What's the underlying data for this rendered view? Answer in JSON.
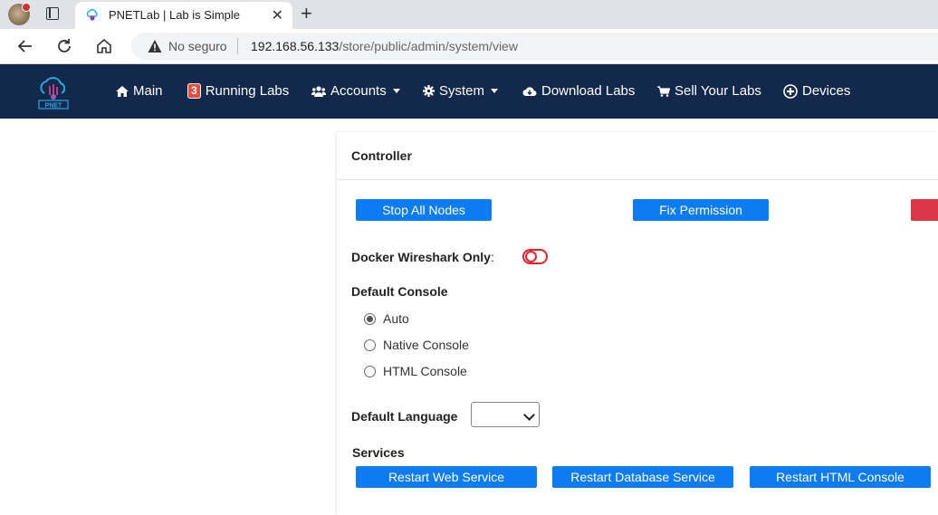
{
  "browser": {
    "tab_title": "PNETLab | Lab is Simple",
    "close_symbol": "✕",
    "new_tab_symbol": "+",
    "security_label": "No seguro",
    "url_host": "192.168.56.133",
    "url_path": "/store/public/admin/system/view"
  },
  "navbar": {
    "logo_text": "PNET",
    "items": [
      {
        "label": "Main",
        "icon": "home-icon"
      },
      {
        "label": "Running Labs",
        "badge": "3"
      },
      {
        "label": "Accounts",
        "icon": "users-icon",
        "dropdown": true
      },
      {
        "label": "System",
        "icon": "gear-icon",
        "dropdown": true
      },
      {
        "label": "Download Labs",
        "icon": "cloud-download-icon"
      },
      {
        "label": "Sell Your Labs",
        "icon": "cart-icon"
      },
      {
        "label": "Devices",
        "icon": "plus-circle-icon"
      }
    ]
  },
  "controller": {
    "title": "Controller",
    "stop_all_nodes": "Stop All Nodes",
    "fix_permission": "Fix Permission",
    "docker_wireshark_label": "Docker Wireshark Only",
    "docker_wireshark_suffix": ":",
    "docker_wireshark_enabled": false
  },
  "default_console": {
    "title": "Default Console",
    "options": [
      {
        "label": "Auto",
        "checked": true
      },
      {
        "label": "Native Console",
        "checked": false
      },
      {
        "label": "HTML Console",
        "checked": false
      }
    ]
  },
  "default_language": {
    "label": "Default Language",
    "selected": ""
  },
  "services": {
    "title": "Services",
    "restart_web": "Restart Web Service",
    "restart_database": "Restart Database Service",
    "restart_html_console": "Restart HTML Console"
  },
  "colors": {
    "navbar_bg": "#13294b",
    "primary_button": "#0d7cf2",
    "danger": "#dc3545",
    "toggle_off": "#e8202a"
  }
}
